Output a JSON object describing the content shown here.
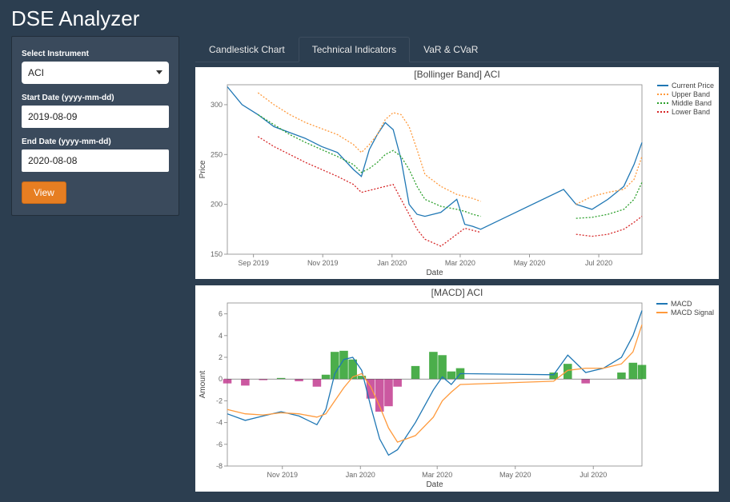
{
  "app": {
    "title": "DSE Analyzer"
  },
  "sidebar": {
    "instrument_label": "Select Instrument",
    "instrument_value": "ACI",
    "start_label": "Start Date (yyyy-mm-dd)",
    "start_value": "2019-08-09",
    "end_label": "End Date (yyyy-mm-dd)",
    "end_value": "2020-08-08",
    "view_label": "View"
  },
  "tabs": {
    "items": [
      "Candlestick Chart",
      "Technical Indicators",
      "VaR & CVaR"
    ],
    "active_index": 1
  },
  "chart_data": [
    {
      "type": "line",
      "title": "[Bollinger Band] ACI",
      "xlabel": "Date",
      "ylabel": "Price",
      "ylim": [
        150,
        320
      ],
      "x_ticks": [
        "Sep 2019",
        "Nov 2019",
        "Jan 2020",
        "Mar 2020",
        "May 2020",
        "Jul 2020"
      ],
      "y_ticks": [
        150,
        200,
        250,
        300
      ],
      "legend": [
        "Current Price",
        "Upper Band",
        "Middle Band",
        "Lower Band"
      ],
      "colors": [
        "#1f77b4",
        "#ff9a3c",
        "#2ca02c",
        "#d62728"
      ],
      "styles": [
        "solid",
        "dotted",
        "dotted",
        "dotted"
      ],
      "x": [
        "2019-08-09",
        "2019-08-22",
        "2019-09-05",
        "2019-09-19",
        "2019-10-03",
        "2019-10-17",
        "2019-10-31",
        "2019-11-14",
        "2019-11-28",
        "2019-12-05",
        "2019-12-12",
        "2019-12-19",
        "2019-12-26",
        "2020-01-02",
        "2020-01-09",
        "2020-01-16",
        "2020-01-23",
        "2020-01-30",
        "2020-02-13",
        "2020-02-27",
        "2020-03-05",
        "2020-03-12",
        "2020-03-19",
        "2020-05-31",
        "2020-06-11",
        "2020-06-25",
        "2020-07-09",
        "2020-07-23",
        "2020-08-01",
        "2020-08-08"
      ],
      "series": [
        {
          "name": "Current Price",
          "values": [
            318,
            300,
            290,
            278,
            272,
            266,
            258,
            252,
            235,
            228,
            255,
            270,
            282,
            275,
            245,
            200,
            190,
            188,
            192,
            205,
            180,
            178,
            175,
            215,
            200,
            195,
            205,
            218,
            240,
            262
          ]
        },
        {
          "name": "Upper Band",
          "values": [
            null,
            null,
            312,
            300,
            290,
            282,
            276,
            270,
            260,
            252,
            260,
            270,
            285,
            292,
            290,
            278,
            255,
            230,
            218,
            210,
            208,
            206,
            203,
            null,
            200,
            208,
            212,
            215,
            225,
            248
          ]
        },
        {
          "name": "Middle Band",
          "values": [
            null,
            null,
            290,
            280,
            270,
            262,
            255,
            248,
            240,
            232,
            236,
            242,
            250,
            254,
            248,
            235,
            218,
            205,
            198,
            195,
            193,
            190,
            188,
            null,
            186,
            187,
            190,
            195,
            205,
            222
          ]
        },
        {
          "name": "Lower Band",
          "values": [
            null,
            null,
            268,
            258,
            250,
            242,
            235,
            228,
            220,
            212,
            214,
            216,
            218,
            220,
            205,
            190,
            175,
            165,
            158,
            170,
            176,
            174,
            172,
            null,
            170,
            168,
            170,
            175,
            182,
            188
          ]
        }
      ]
    },
    {
      "type": "line",
      "title": "[MACD] ACI",
      "xlabel": "Date",
      "ylabel": "Amount",
      "ylim": [
        -8,
        7
      ],
      "x_ticks": [
        "Nov 2019",
        "Jan 2020",
        "Mar 2020",
        "May 2020",
        "Jul 2020"
      ],
      "y_ticks": [
        -8,
        -6,
        -4,
        -2,
        0,
        2,
        4,
        6
      ],
      "legend": [
        "MACD",
        "MACD Signal"
      ],
      "colors": [
        "#1f77b4",
        "#ff9a3c"
      ],
      "styles": [
        "solid",
        "solid"
      ],
      "x": [
        "2019-09-19",
        "2019-10-03",
        "2019-10-17",
        "2019-10-31",
        "2019-11-14",
        "2019-11-28",
        "2019-12-05",
        "2019-12-12",
        "2019-12-19",
        "2019-12-26",
        "2020-01-02",
        "2020-01-09",
        "2020-01-16",
        "2020-01-23",
        "2020-01-30",
        "2020-02-13",
        "2020-02-27",
        "2020-03-05",
        "2020-03-12",
        "2020-03-19",
        "2020-05-31",
        "2020-06-11",
        "2020-06-25",
        "2020-07-09",
        "2020-07-23",
        "2020-08-01",
        "2020-08-08"
      ],
      "series": [
        {
          "name": "MACD",
          "values": [
            -3.2,
            -3.8,
            -3.4,
            -3.0,
            -3.4,
            -4.2,
            -2.8,
            0.5,
            1.8,
            2.0,
            0.8,
            -2.5,
            -5.5,
            -7.0,
            -6.5,
            -4.0,
            -1.0,
            0.2,
            -0.5,
            0.5,
            0.4,
            2.2,
            0.6,
            1.0,
            2.0,
            4.0,
            6.3
          ]
        },
        {
          "name": "MACD Signal",
          "values": [
            -2.8,
            -3.2,
            -3.3,
            -3.1,
            -3.2,
            -3.5,
            -3.2,
            -2.0,
            -0.8,
            0.2,
            0.5,
            -0.7,
            -2.5,
            -4.5,
            -5.8,
            -5.2,
            -3.5,
            -2.0,
            -1.2,
            -0.5,
            -0.2,
            0.8,
            1.0,
            1.0,
            1.4,
            2.5,
            5.0
          ]
        }
      ],
      "histogram": {
        "pos_color": "#2ca02c",
        "neg_color": "#c23b8f",
        "values": [
          -0.4,
          -0.6,
          -0.1,
          0.1,
          -0.2,
          -0.7,
          0.4,
          2.5,
          2.6,
          1.8,
          0.3,
          -1.8,
          -3.0,
          -2.5,
          -0.7,
          1.2,
          2.5,
          2.2,
          0.7,
          1.0,
          0.6,
          1.4,
          -0.4,
          0.0,
          0.6,
          1.5,
          1.3
        ]
      }
    }
  ]
}
